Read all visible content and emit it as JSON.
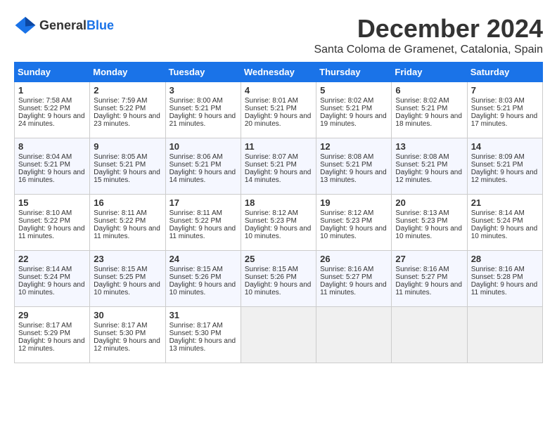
{
  "header": {
    "logo_general": "General",
    "logo_blue": "Blue",
    "month_title": "December 2024",
    "location": "Santa Coloma de Gramenet, Catalonia, Spain"
  },
  "weekdays": [
    "Sunday",
    "Monday",
    "Tuesday",
    "Wednesday",
    "Thursday",
    "Friday",
    "Saturday"
  ],
  "weeks": [
    [
      {
        "day": "1",
        "sunrise": "Sunrise: 7:58 AM",
        "sunset": "Sunset: 5:22 PM",
        "daylight": "Daylight: 9 hours and 24 minutes."
      },
      {
        "day": "2",
        "sunrise": "Sunrise: 7:59 AM",
        "sunset": "Sunset: 5:22 PM",
        "daylight": "Daylight: 9 hours and 23 minutes."
      },
      {
        "day": "3",
        "sunrise": "Sunrise: 8:00 AM",
        "sunset": "Sunset: 5:21 PM",
        "daylight": "Daylight: 9 hours and 21 minutes."
      },
      {
        "day": "4",
        "sunrise": "Sunrise: 8:01 AM",
        "sunset": "Sunset: 5:21 PM",
        "daylight": "Daylight: 9 hours and 20 minutes."
      },
      {
        "day": "5",
        "sunrise": "Sunrise: 8:02 AM",
        "sunset": "Sunset: 5:21 PM",
        "daylight": "Daylight: 9 hours and 19 minutes."
      },
      {
        "day": "6",
        "sunrise": "Sunrise: 8:02 AM",
        "sunset": "Sunset: 5:21 PM",
        "daylight": "Daylight: 9 hours and 18 minutes."
      },
      {
        "day": "7",
        "sunrise": "Sunrise: 8:03 AM",
        "sunset": "Sunset: 5:21 PM",
        "daylight": "Daylight: 9 hours and 17 minutes."
      }
    ],
    [
      {
        "day": "8",
        "sunrise": "Sunrise: 8:04 AM",
        "sunset": "Sunset: 5:21 PM",
        "daylight": "Daylight: 9 hours and 16 minutes."
      },
      {
        "day": "9",
        "sunrise": "Sunrise: 8:05 AM",
        "sunset": "Sunset: 5:21 PM",
        "daylight": "Daylight: 9 hours and 15 minutes."
      },
      {
        "day": "10",
        "sunrise": "Sunrise: 8:06 AM",
        "sunset": "Sunset: 5:21 PM",
        "daylight": "Daylight: 9 hours and 14 minutes."
      },
      {
        "day": "11",
        "sunrise": "Sunrise: 8:07 AM",
        "sunset": "Sunset: 5:21 PM",
        "daylight": "Daylight: 9 hours and 14 minutes."
      },
      {
        "day": "12",
        "sunrise": "Sunrise: 8:08 AM",
        "sunset": "Sunset: 5:21 PM",
        "daylight": "Daylight: 9 hours and 13 minutes."
      },
      {
        "day": "13",
        "sunrise": "Sunrise: 8:08 AM",
        "sunset": "Sunset: 5:21 PM",
        "daylight": "Daylight: 9 hours and 12 minutes."
      },
      {
        "day": "14",
        "sunrise": "Sunrise: 8:09 AM",
        "sunset": "Sunset: 5:21 PM",
        "daylight": "Daylight: 9 hours and 12 minutes."
      }
    ],
    [
      {
        "day": "15",
        "sunrise": "Sunrise: 8:10 AM",
        "sunset": "Sunset: 5:22 PM",
        "daylight": "Daylight: 9 hours and 11 minutes."
      },
      {
        "day": "16",
        "sunrise": "Sunrise: 8:11 AM",
        "sunset": "Sunset: 5:22 PM",
        "daylight": "Daylight: 9 hours and 11 minutes."
      },
      {
        "day": "17",
        "sunrise": "Sunrise: 8:11 AM",
        "sunset": "Sunset: 5:22 PM",
        "daylight": "Daylight: 9 hours and 11 minutes."
      },
      {
        "day": "18",
        "sunrise": "Sunrise: 8:12 AM",
        "sunset": "Sunset: 5:23 PM",
        "daylight": "Daylight: 9 hours and 10 minutes."
      },
      {
        "day": "19",
        "sunrise": "Sunrise: 8:12 AM",
        "sunset": "Sunset: 5:23 PM",
        "daylight": "Daylight: 9 hours and 10 minutes."
      },
      {
        "day": "20",
        "sunrise": "Sunrise: 8:13 AM",
        "sunset": "Sunset: 5:23 PM",
        "daylight": "Daylight: 9 hours and 10 minutes."
      },
      {
        "day": "21",
        "sunrise": "Sunrise: 8:14 AM",
        "sunset": "Sunset: 5:24 PM",
        "daylight": "Daylight: 9 hours and 10 minutes."
      }
    ],
    [
      {
        "day": "22",
        "sunrise": "Sunrise: 8:14 AM",
        "sunset": "Sunset: 5:24 PM",
        "daylight": "Daylight: 9 hours and 10 minutes."
      },
      {
        "day": "23",
        "sunrise": "Sunrise: 8:15 AM",
        "sunset": "Sunset: 5:25 PM",
        "daylight": "Daylight: 9 hours and 10 minutes."
      },
      {
        "day": "24",
        "sunrise": "Sunrise: 8:15 AM",
        "sunset": "Sunset: 5:26 PM",
        "daylight": "Daylight: 9 hours and 10 minutes."
      },
      {
        "day": "25",
        "sunrise": "Sunrise: 8:15 AM",
        "sunset": "Sunset: 5:26 PM",
        "daylight": "Daylight: 9 hours and 10 minutes."
      },
      {
        "day": "26",
        "sunrise": "Sunrise: 8:16 AM",
        "sunset": "Sunset: 5:27 PM",
        "daylight": "Daylight: 9 hours and 11 minutes."
      },
      {
        "day": "27",
        "sunrise": "Sunrise: 8:16 AM",
        "sunset": "Sunset: 5:27 PM",
        "daylight": "Daylight: 9 hours and 11 minutes."
      },
      {
        "day": "28",
        "sunrise": "Sunrise: 8:16 AM",
        "sunset": "Sunset: 5:28 PM",
        "daylight": "Daylight: 9 hours and 11 minutes."
      }
    ],
    [
      {
        "day": "29",
        "sunrise": "Sunrise: 8:17 AM",
        "sunset": "Sunset: 5:29 PM",
        "daylight": "Daylight: 9 hours and 12 minutes."
      },
      {
        "day": "30",
        "sunrise": "Sunrise: 8:17 AM",
        "sunset": "Sunset: 5:30 PM",
        "daylight": "Daylight: 9 hours and 12 minutes."
      },
      {
        "day": "31",
        "sunrise": "Sunrise: 8:17 AM",
        "sunset": "Sunset: 5:30 PM",
        "daylight": "Daylight: 9 hours and 13 minutes."
      },
      null,
      null,
      null,
      null
    ]
  ]
}
